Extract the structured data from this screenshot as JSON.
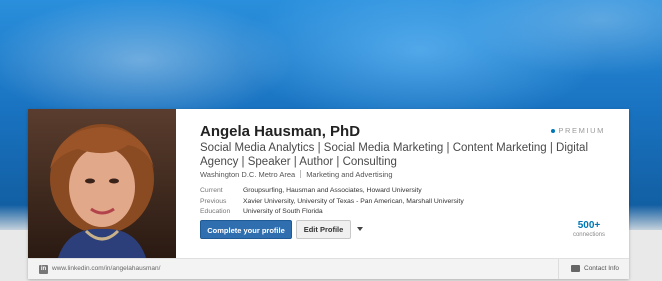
{
  "profile": {
    "name": "Angela Hausman, PhD",
    "badge": "PREMIUM",
    "headline": "Social Media Analytics | Social Media Marketing | Content Marketing | Digital Agency | Speaker | Author | Consulting",
    "location": "Washington D.C. Metro Area",
    "industry": "Marketing and Advertising",
    "facts": [
      {
        "key": "Current",
        "value": "Groupsurfing, Hausman and Associates, Howard University"
      },
      {
        "key": "Previous",
        "value": "Xavier University, University of Texas - Pan American, Marshall University"
      },
      {
        "key": "Education",
        "value": "University of South Florida"
      }
    ],
    "actions": {
      "complete_label": "Complete your profile",
      "edit_label": "Edit Profile"
    },
    "connections": {
      "count": "500+",
      "label": "connections"
    },
    "footer": {
      "network_icon_glyph": "in",
      "url": "www.linkedin.com/in/angelahausman/",
      "contact_label": "Contact Info"
    }
  },
  "colors": {
    "accent": "#0077b5",
    "primary_button": "#2f6fb0",
    "banner": "#1a74c2"
  },
  "icons": {
    "network": "linkedin-icon",
    "contact": "contact-card-icon",
    "dropdown": "chevron-down-icon"
  }
}
